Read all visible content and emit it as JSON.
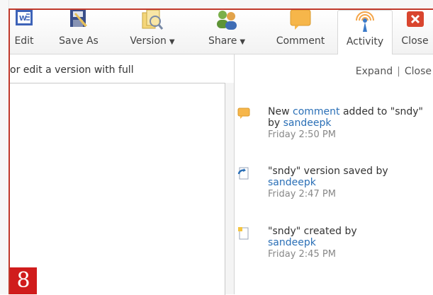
{
  "toolbar": {
    "buttons": [
      {
        "label": "Edit"
      },
      {
        "label": "Save As"
      },
      {
        "label": "Version",
        "dropdown": "▼"
      },
      {
        "label": "Share",
        "dropdown": "▼"
      },
      {
        "label": "Comment"
      },
      {
        "label": "Activity"
      },
      {
        "label": "Close"
      }
    ]
  },
  "document": {
    "message": "or edit a version with full"
  },
  "activity": {
    "expand_label": "Expand",
    "separator": "|",
    "close_label": "Close",
    "items": [
      {
        "icon": "comment-icon",
        "pre": "New ",
        "link": "comment",
        "mid": " added to \"sndy\" by ",
        "user": "sandeepk",
        "time": "Friday 2:50 PM"
      },
      {
        "icon": "version-saved-icon",
        "pre": "\"sndy\" version saved by",
        "user": "sandeepk",
        "time": "Friday 2:47 PM"
      },
      {
        "icon": "created-icon",
        "pre": "\"sndy\" created by",
        "user": "sandeepk",
        "time": "Friday 2:45 PM"
      }
    ]
  },
  "badge": {
    "number": "8"
  },
  "colors": {
    "frame": "#c0392b",
    "badge": "#d01c1c",
    "link": "#2a6fb6"
  }
}
